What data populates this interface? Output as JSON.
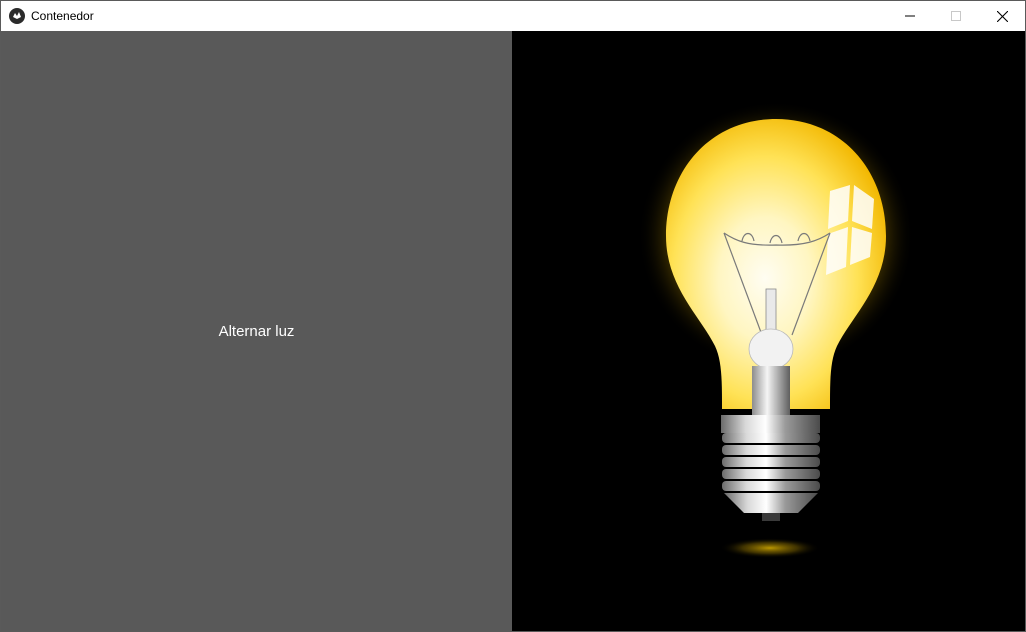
{
  "window": {
    "title": "Contenedor",
    "app_icon": "kivy-icon",
    "controls": [
      "minimize-icon",
      "maximize-icon",
      "close-icon"
    ]
  },
  "left_panel": {
    "button_label": "Alternar luz",
    "background": "#595959"
  },
  "right_panel": {
    "image": "lightbulb-on",
    "background": "#000000"
  }
}
